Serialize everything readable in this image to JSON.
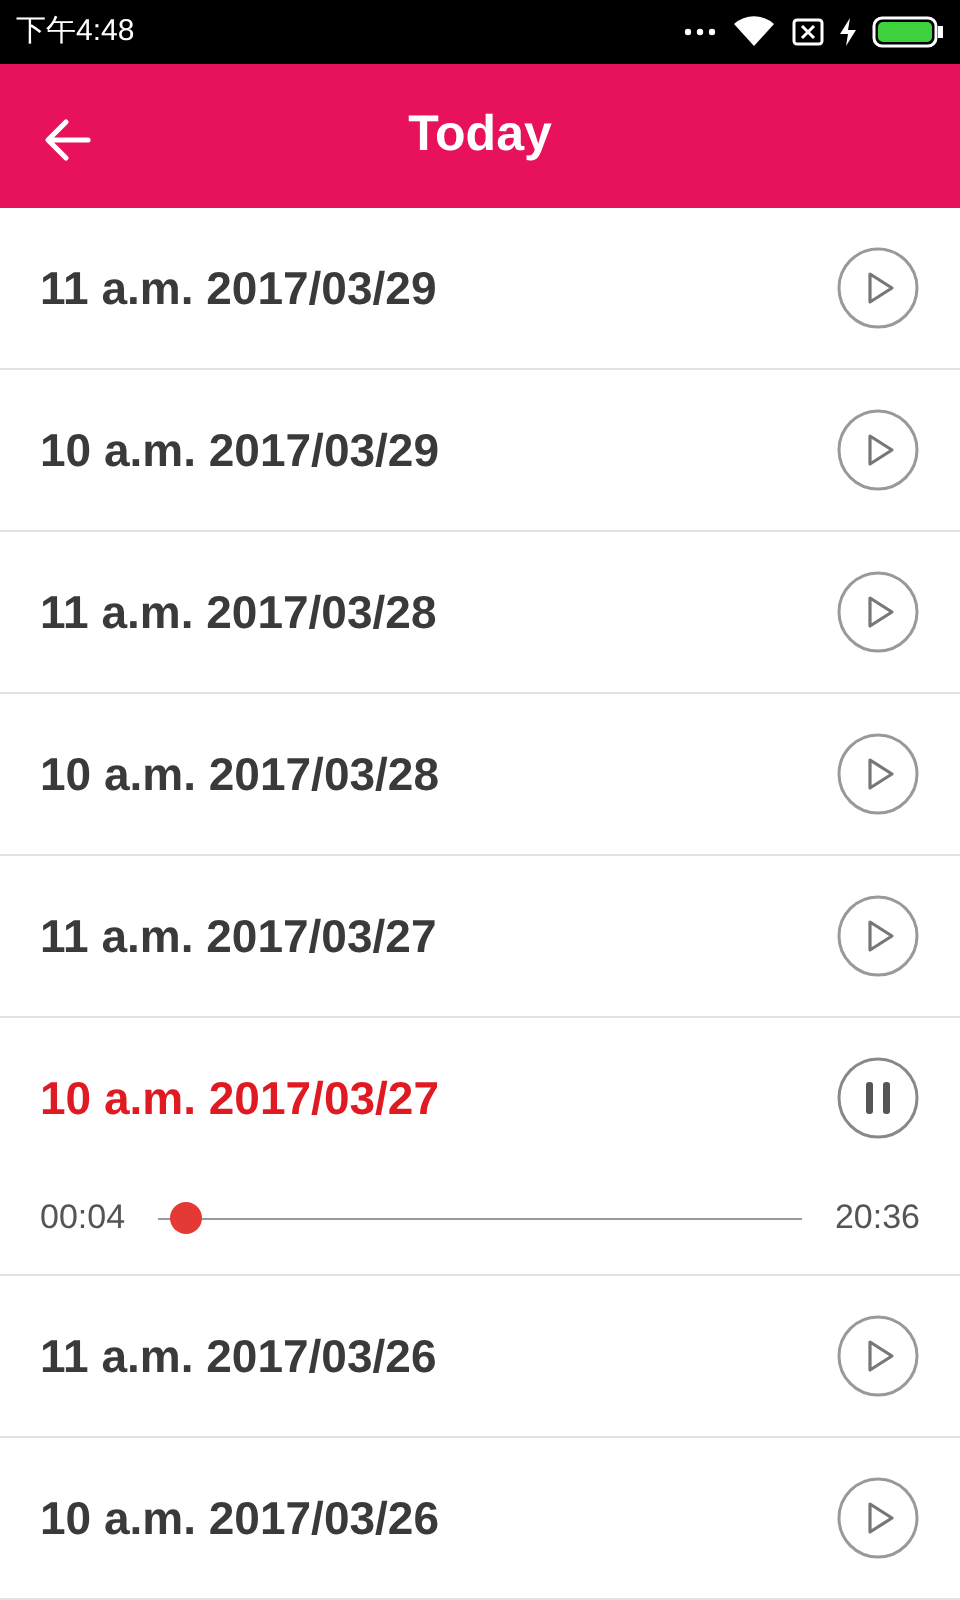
{
  "status_bar": {
    "time": "下午4:48"
  },
  "header": {
    "title": "Today"
  },
  "episodes": [
    {
      "title": "11 a.m. 2017/03/29",
      "selected": false
    },
    {
      "title": "10 a.m. 2017/03/29",
      "selected": false
    },
    {
      "title": "11 a.m. 2017/03/28",
      "selected": false
    },
    {
      "title": "10 a.m. 2017/03/28",
      "selected": false
    },
    {
      "title": "11 a.m. 2017/03/27",
      "selected": false
    },
    {
      "title": "10 a.m. 2017/03/27",
      "selected": true,
      "player": {
        "elapsed": "00:04",
        "total": "20:36",
        "level": 0.02
      }
    },
    {
      "title": "11 a.m. 2017/03/26",
      "selected": false
    },
    {
      "title": "10 a.m. 2017/03/26",
      "selected": false
    }
  ]
}
